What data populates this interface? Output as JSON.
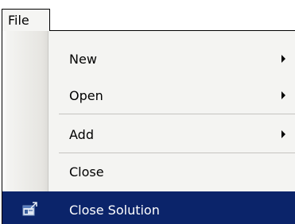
{
  "menubar": {
    "file_label": "File"
  },
  "menu": {
    "items": [
      {
        "label": "New",
        "has_submenu": true
      },
      {
        "label": "Open",
        "has_submenu": true
      },
      {
        "label": "Add",
        "has_submenu": true
      },
      {
        "label": "Close",
        "has_submenu": false
      },
      {
        "label": "Close Solution",
        "has_submenu": false,
        "icon": "close-solution-icon",
        "highlighted": true
      }
    ]
  },
  "colors": {
    "highlight": "#0b246a",
    "menu_background": "#f4f4f2"
  }
}
